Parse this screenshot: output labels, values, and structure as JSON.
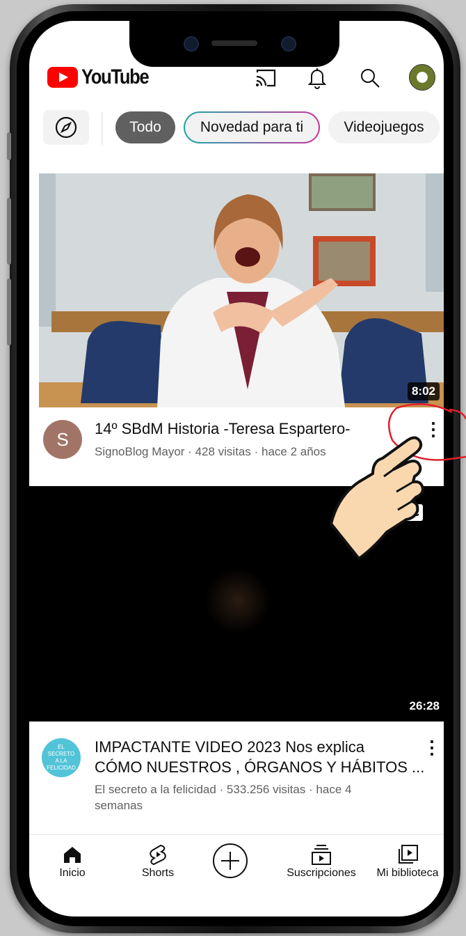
{
  "header": {
    "logo_text": "YouTube",
    "icons": [
      "cast-icon",
      "bell-icon",
      "search-icon",
      "avatar"
    ]
  },
  "chips": [
    "Todo",
    "Novedad para ti",
    "Videojuegos"
  ],
  "videos": [
    {
      "duration": "8:02",
      "title": "14º SBdM Historia -Teresa Espartero-",
      "channel_initial": "S",
      "meta": "SignoBlog Mayor · 428 visitas · hace 2 años"
    },
    {
      "duration": "26:28",
      "badge": "CC",
      "channel_avatar_text": "EL SECRETO A LA FELICIDAD",
      "title_line1": "IMPACTANTE VIDEO 2023 Nos explica",
      "title_line2": "CÓMO NUESTROS , ÓRGANOS Y HÁBITOS ...",
      "meta_line1": "El secreto a la felicidad · 533.256 visitas · hace 4",
      "meta_line2": "semanas"
    }
  ],
  "nav": [
    "Inicio",
    "Shorts",
    "Suscripciones",
    "Mi biblioteca"
  ],
  "colors": {
    "brand_red": "#ff0000",
    "chip_active": "#606060",
    "annotation_red": "#e0202a"
  }
}
